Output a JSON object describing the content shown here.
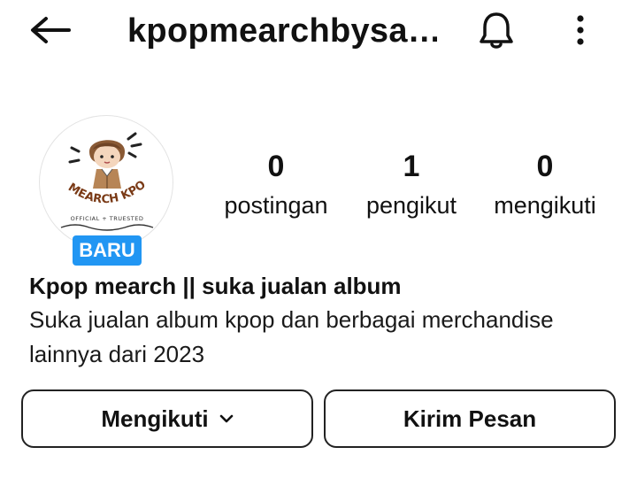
{
  "header": {
    "title": "kpopmearchbysa…",
    "back_icon": "arrow-left-icon",
    "notification_icon": "bell-icon",
    "menu_icon": "more-vertical-icon"
  },
  "profile": {
    "avatar_text": {
      "top": "MEARCH KPOP",
      "bottom": "OFFICIAL + TRUESTED"
    },
    "badge": "BARU",
    "badge_color": "#2196f3",
    "stats": [
      {
        "value": "0",
        "label": "postingan"
      },
      {
        "value": "1",
        "label": "pengikut"
      },
      {
        "value": "0",
        "label": "mengikuti"
      }
    ],
    "name": "Kpop mearch || suka jualan album",
    "bio": "Suka jualan album kpop dan berbagai merchandise lainnya dari 2023"
  },
  "actions": {
    "following_label": "Mengikuti",
    "following_icon": "chevron-down-icon",
    "message_label": "Kirim Pesan"
  }
}
